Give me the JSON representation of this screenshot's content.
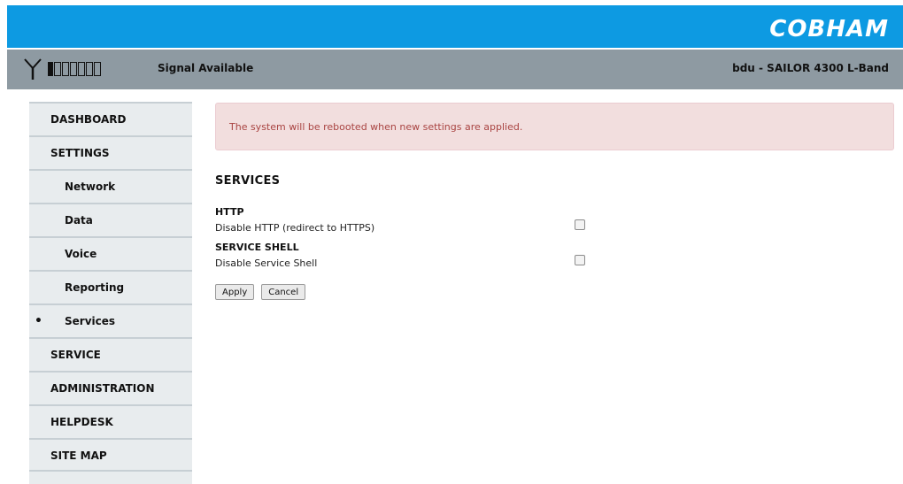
{
  "header": {
    "logo_text": "COBHAM",
    "brand_color": "#0d9ae2"
  },
  "status": {
    "signal_text": "Signal Available",
    "device_text": "bdu - SAILOR 4300 L-Band",
    "signal_bars_filled": 1,
    "signal_bars_total": 7,
    "antenna_icon": "antenna-icon"
  },
  "sidebar": {
    "items": [
      {
        "label": "DASHBOARD",
        "level": 0
      },
      {
        "label": "SETTINGS",
        "level": 0
      },
      {
        "label": "Network",
        "level": 1
      },
      {
        "label": "Data",
        "level": 1
      },
      {
        "label": "Voice",
        "level": 1
      },
      {
        "label": "Reporting",
        "level": 1
      },
      {
        "label": "Services",
        "level": 1,
        "active": true,
        "bullet": "•"
      },
      {
        "label": "SERVICE",
        "level": 0
      },
      {
        "label": "ADMINISTRATION",
        "level": 0
      },
      {
        "label": "HELPDESK",
        "level": 0
      },
      {
        "label": "SITE MAP",
        "level": 0
      }
    ]
  },
  "main": {
    "alert_text": "The system will be rebooted when new settings are applied.",
    "section_title": "SERVICES",
    "http": {
      "title": "HTTP",
      "label": "Disable HTTP (redirect to HTTPS)",
      "checked": false
    },
    "shell": {
      "title": "SERVICE SHELL",
      "label": "Disable Service Shell",
      "checked": false
    },
    "apply_label": "Apply",
    "cancel_label": "Cancel"
  }
}
